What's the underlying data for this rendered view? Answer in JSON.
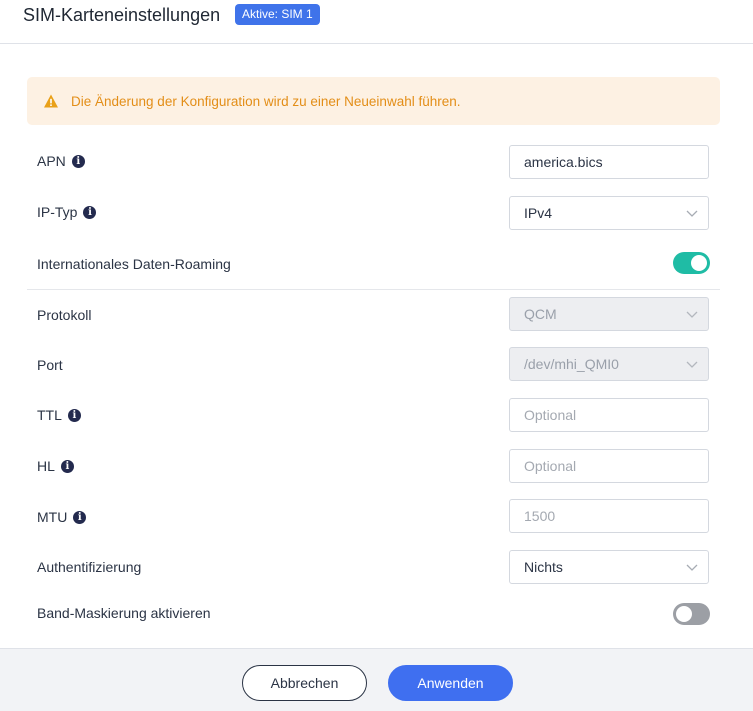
{
  "header": {
    "title": "SIM-Karteneinstellungen",
    "badge": "Aktive: SIM 1"
  },
  "warning": {
    "icon": "warning-icon",
    "text": "Die Änderung der Konfiguration wird zu einer Neueinwahl führen."
  },
  "form": {
    "apn": {
      "label": "APN",
      "value": "america.bics"
    },
    "ip_type": {
      "label": "IP-Typ",
      "value": "IPv4"
    },
    "roaming": {
      "label": "Internationales Daten-Roaming",
      "enabled": true
    },
    "protocol": {
      "label": "Protokoll",
      "value": "QCM"
    },
    "port": {
      "label": "Port",
      "value": "/dev/mhi_QMI0"
    },
    "ttl": {
      "label": "TTL",
      "placeholder": "Optional"
    },
    "hl": {
      "label": "HL",
      "placeholder": "Optional"
    },
    "mtu": {
      "label": "MTU",
      "placeholder": "1500"
    },
    "auth": {
      "label": "Authentifizierung",
      "value": "Nichts"
    },
    "band_mask": {
      "label": "Band-Maskierung aktivieren",
      "enabled": false
    }
  },
  "footer": {
    "cancel_label": "Abbrechen",
    "apply_label": "Anwenden"
  },
  "colors": {
    "accent": "#3f6ff0",
    "toggle_on": "#1fbca5",
    "warning_text": "#e38e18",
    "warning_bg": "#fdf1e3"
  }
}
